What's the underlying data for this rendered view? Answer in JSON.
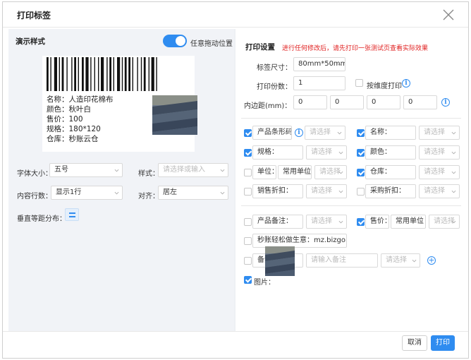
{
  "dialog": {
    "title": "打印标签"
  },
  "left": {
    "heading": "演示样式",
    "drag_toggle_label": "任意拖动位置",
    "drag_toggle_on": true,
    "preview": {
      "lines": [
        "名称：人造印花棉布",
        "颜色：秋叶白",
        "售价：100",
        "规格：180*120",
        "仓库：秒账云仓"
      ]
    },
    "font_size_label": "字体大小：",
    "font_size_value": "五号",
    "style_label": "样式：",
    "style_placeholder": "请选择或输入",
    "rows_label": "内容行数：",
    "rows_value": "显示1行",
    "align_label": "对齐：",
    "align_value": "居左",
    "vertical_label": "垂直等距分布："
  },
  "right": {
    "heading": "打印设置",
    "notice": "进行任何修改后，请先打印一张测试页查看实际效果",
    "size_label": "标签尺寸：",
    "size_value": "80mm*50mm",
    "copies_label": "打印份数：",
    "copies_value": "1",
    "by_dimension_label": "按维度打印",
    "padding_label": "内边距(mm)：",
    "padding_values": [
      "0",
      "0",
      "0",
      "0"
    ],
    "placeholder_select": "请选择",
    "fields": {
      "barcode": {
        "label": "产品条形码",
        "checked": true
      },
      "name": {
        "label": "名称：",
        "checked": true
      },
      "spec": {
        "label": "规格：",
        "checked": true
      },
      "color": {
        "label": "颜色：",
        "checked": true
      },
      "unit": {
        "label": "单位：",
        "checked": false,
        "value": "常用单位"
      },
      "warehouse": {
        "label": "仓库：",
        "checked": true
      },
      "sale_discount": {
        "label": "销售折扣：",
        "checked": false
      },
      "purchase_discount": {
        "label": "采购折扣：",
        "checked": false
      },
      "product_note": {
        "label": "产品备注：",
        "checked": false
      },
      "price": {
        "label": "售价：",
        "checked": true,
        "value": "常用单位"
      },
      "slogan": {
        "label": "秒账轻松做生意：",
        "checked": false,
        "value": "mz.bizgo.com"
      },
      "note": {
        "label": "备注：",
        "checked": false,
        "placeholder": "请输入备注"
      },
      "image": {
        "label": "图片：",
        "checked": true
      }
    }
  },
  "footer": {
    "cancel": "取消",
    "print": "打印"
  },
  "colors": {
    "accent": "#2f8cf0",
    "warning": "#e02020"
  }
}
